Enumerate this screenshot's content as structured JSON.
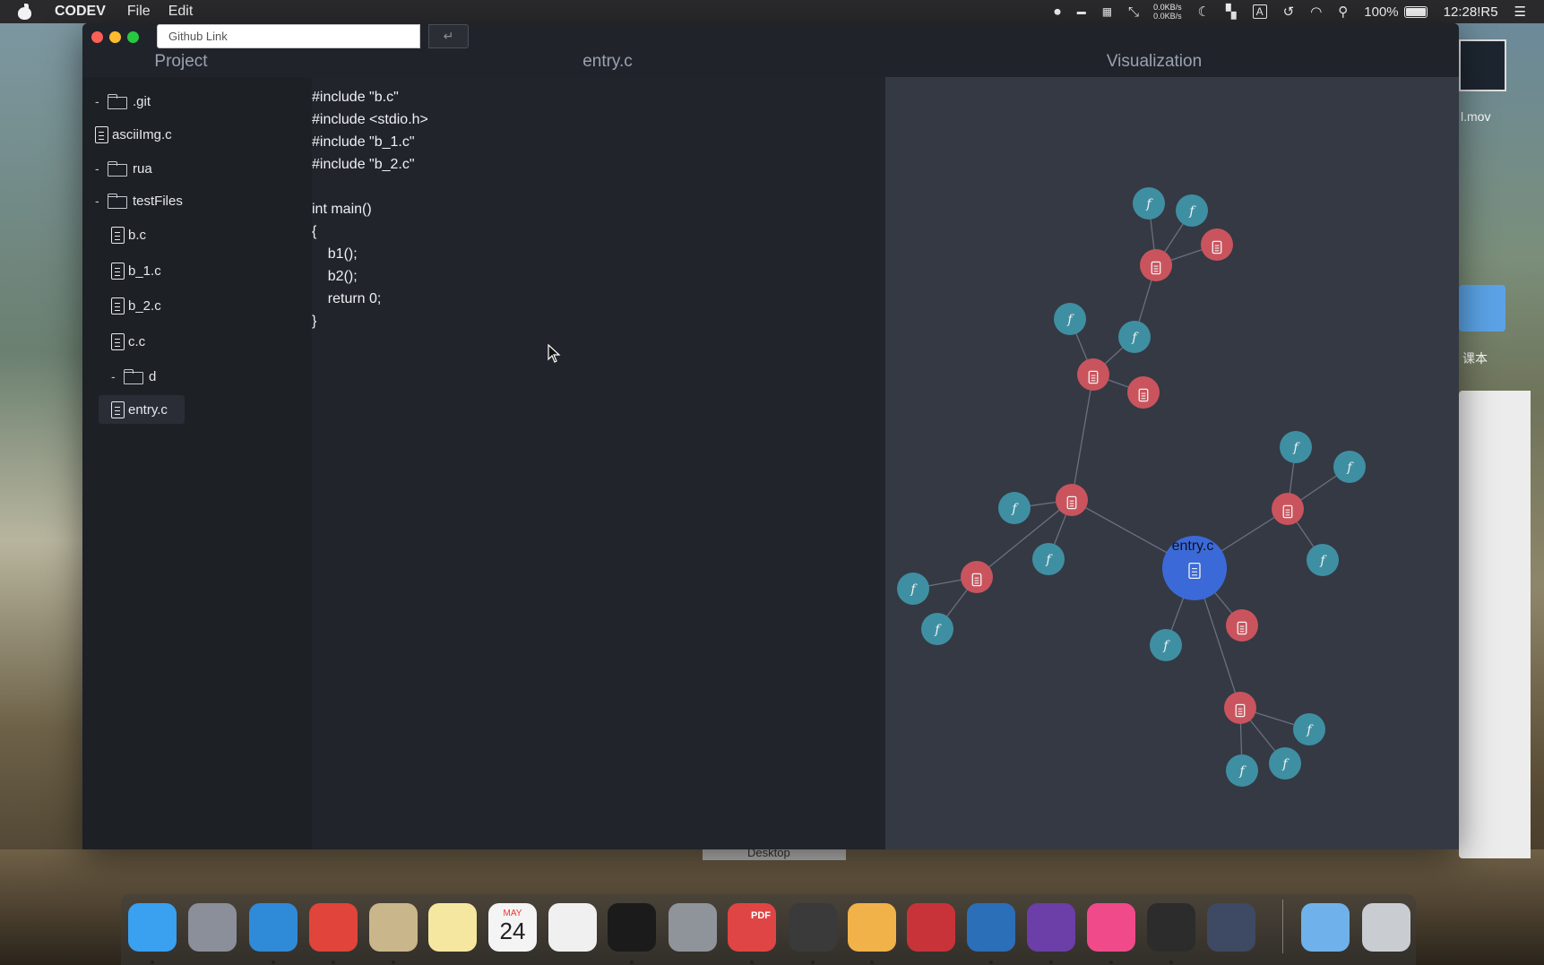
{
  "menubar": {
    "app_name": "CODEV",
    "menus": [
      "File",
      "Edit"
    ],
    "net_up": "0.0KB/s",
    "net_down": "0.0KB/s",
    "input_source": "A",
    "battery": "100%",
    "clock": "12:28!R5"
  },
  "window": {
    "github_placeholder": "Github Link",
    "enter_symbol": "↵"
  },
  "headers": {
    "project": "Project",
    "editor": "entry.c",
    "visualization": "Visualization"
  },
  "tree": [
    {
      "label": ".git",
      "type": "folder",
      "toggle": "-"
    },
    {
      "label": "asciiImg.c",
      "type": "file"
    },
    {
      "label": "rua",
      "type": "folder",
      "toggle": "-"
    },
    {
      "label": "testFiles",
      "type": "folder",
      "toggle": "-"
    },
    {
      "label": "b.c",
      "type": "file"
    },
    {
      "label": "b_1.c",
      "type": "file"
    },
    {
      "label": "b_2.c",
      "type": "file"
    },
    {
      "label": "c.c",
      "type": "file"
    },
    {
      "label": "d",
      "type": "folder",
      "toggle": "-"
    },
    {
      "label": "entry.c",
      "type": "file",
      "selected": true
    }
  ],
  "code": [
    "#include \"b.c\"",
    "#include <stdio.h>",
    "#include \"b_1.c\"",
    "#include \"b_2.c\"",
    "",
    "int main()",
    "{",
    "    b1();",
    "    b2();",
    "    return 0;",
    "}"
  ],
  "graph": {
    "root_label": "entry.c",
    "function_glyph": "f",
    "colors": {
      "file": "#c9545d",
      "function": "#3f8fa3",
      "root": "#3b6ad8",
      "edge": "#6b7080"
    }
  },
  "desktop": {
    "thumb_label": "l.mov",
    "folder_label": "课本",
    "finder_label": "Desktop"
  },
  "dock": {
    "calendar_month": "MAY",
    "calendar_day": "24",
    "pdf_label": "PDF"
  }
}
